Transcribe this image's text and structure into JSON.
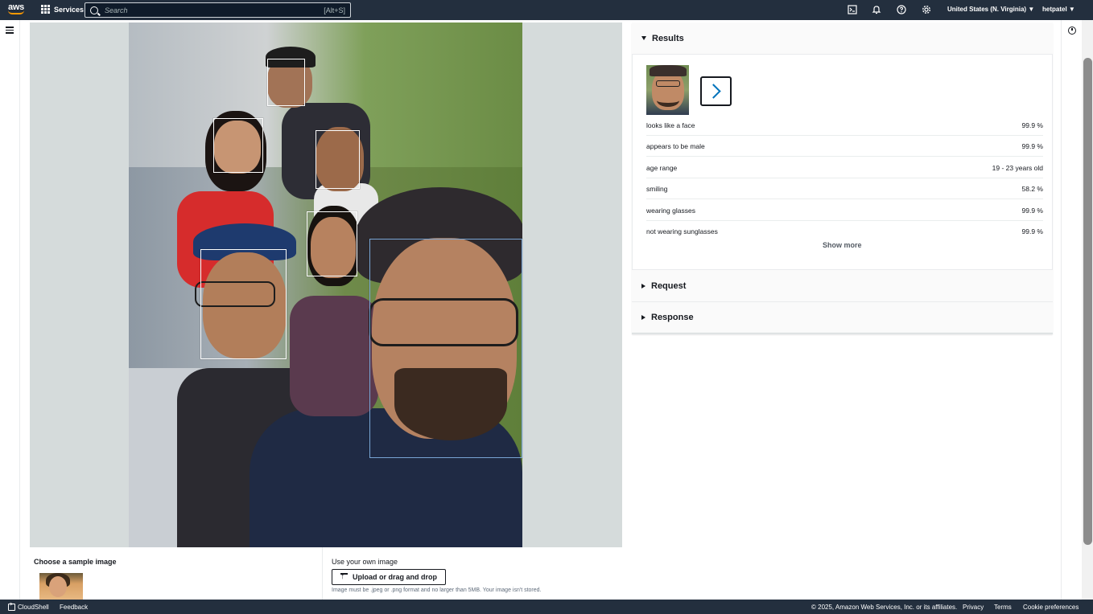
{
  "topnav": {
    "logo": "aws",
    "services": "Services",
    "search_placeholder": "Search",
    "search_shortcut": "[Alt+S]",
    "region": "United States (N. Virginia) ▼",
    "user": "hetpatel ▼"
  },
  "results": {
    "title": "Results",
    "attributes": [
      {
        "label": "looks like a face",
        "value": "99.9 %"
      },
      {
        "label": "appears to be male",
        "value": "99.9 %"
      },
      {
        "label": "age range",
        "value": "19 - 23 years old"
      },
      {
        "label": "smiling",
        "value": "58.2 %"
      },
      {
        "label": "wearing glasses",
        "value": "99.9 %"
      },
      {
        "label": "not wearing sunglasses",
        "value": "99.9 %"
      }
    ],
    "show_more": "Show more"
  },
  "request": {
    "title": "Request"
  },
  "response": {
    "title": "Response"
  },
  "sample": {
    "choose_label": "Choose a sample image",
    "own_label": "Use your own image",
    "upload_label": "Upload or drag and drop",
    "hint": "Image must be .jpeg or .png format and no larger than 5MB. Your image isn't stored."
  },
  "footer": {
    "cloudshell": "CloudShell",
    "feedback": "Feedback",
    "copyright": "© 2025, Amazon Web Services, Inc. or its affiliates.",
    "privacy": "Privacy",
    "terms": "Terms",
    "cookies": "Cookie preferences"
  }
}
